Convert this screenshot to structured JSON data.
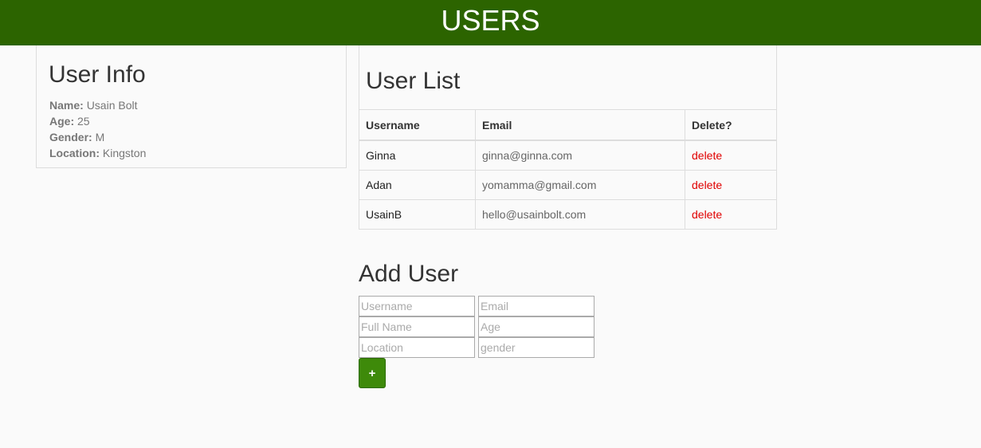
{
  "header": {
    "title": "USERS"
  },
  "user_info": {
    "title": "User Info",
    "fields": [
      {
        "label": "Name:",
        "value": "Usain Bolt"
      },
      {
        "label": "Age:",
        "value": "25"
      },
      {
        "label": "Gender:",
        "value": "M"
      },
      {
        "label": "Location:",
        "value": "Kingston"
      }
    ]
  },
  "user_list": {
    "title": "User List",
    "columns": [
      "Username",
      "Email",
      "Delete?"
    ],
    "rows": [
      {
        "username": "Ginna",
        "email": "ginna@ginna.com",
        "action": "delete"
      },
      {
        "username": "Adan",
        "email": "yomamma@gmail.com",
        "action": "delete"
      },
      {
        "username": "UsainB",
        "email": "hello@usainbolt.com",
        "action": "delete"
      }
    ]
  },
  "add_user": {
    "title": "Add User",
    "placeholders": {
      "username": "Username",
      "email": "Email",
      "full_name": "Full Name",
      "age": "Age",
      "location": "Location",
      "gender": "gender"
    },
    "button_label": "+"
  },
  "colors": {
    "header_bg": "#2c6400",
    "button_bg": "#3e8a0a",
    "delete_link": "#e00000"
  }
}
